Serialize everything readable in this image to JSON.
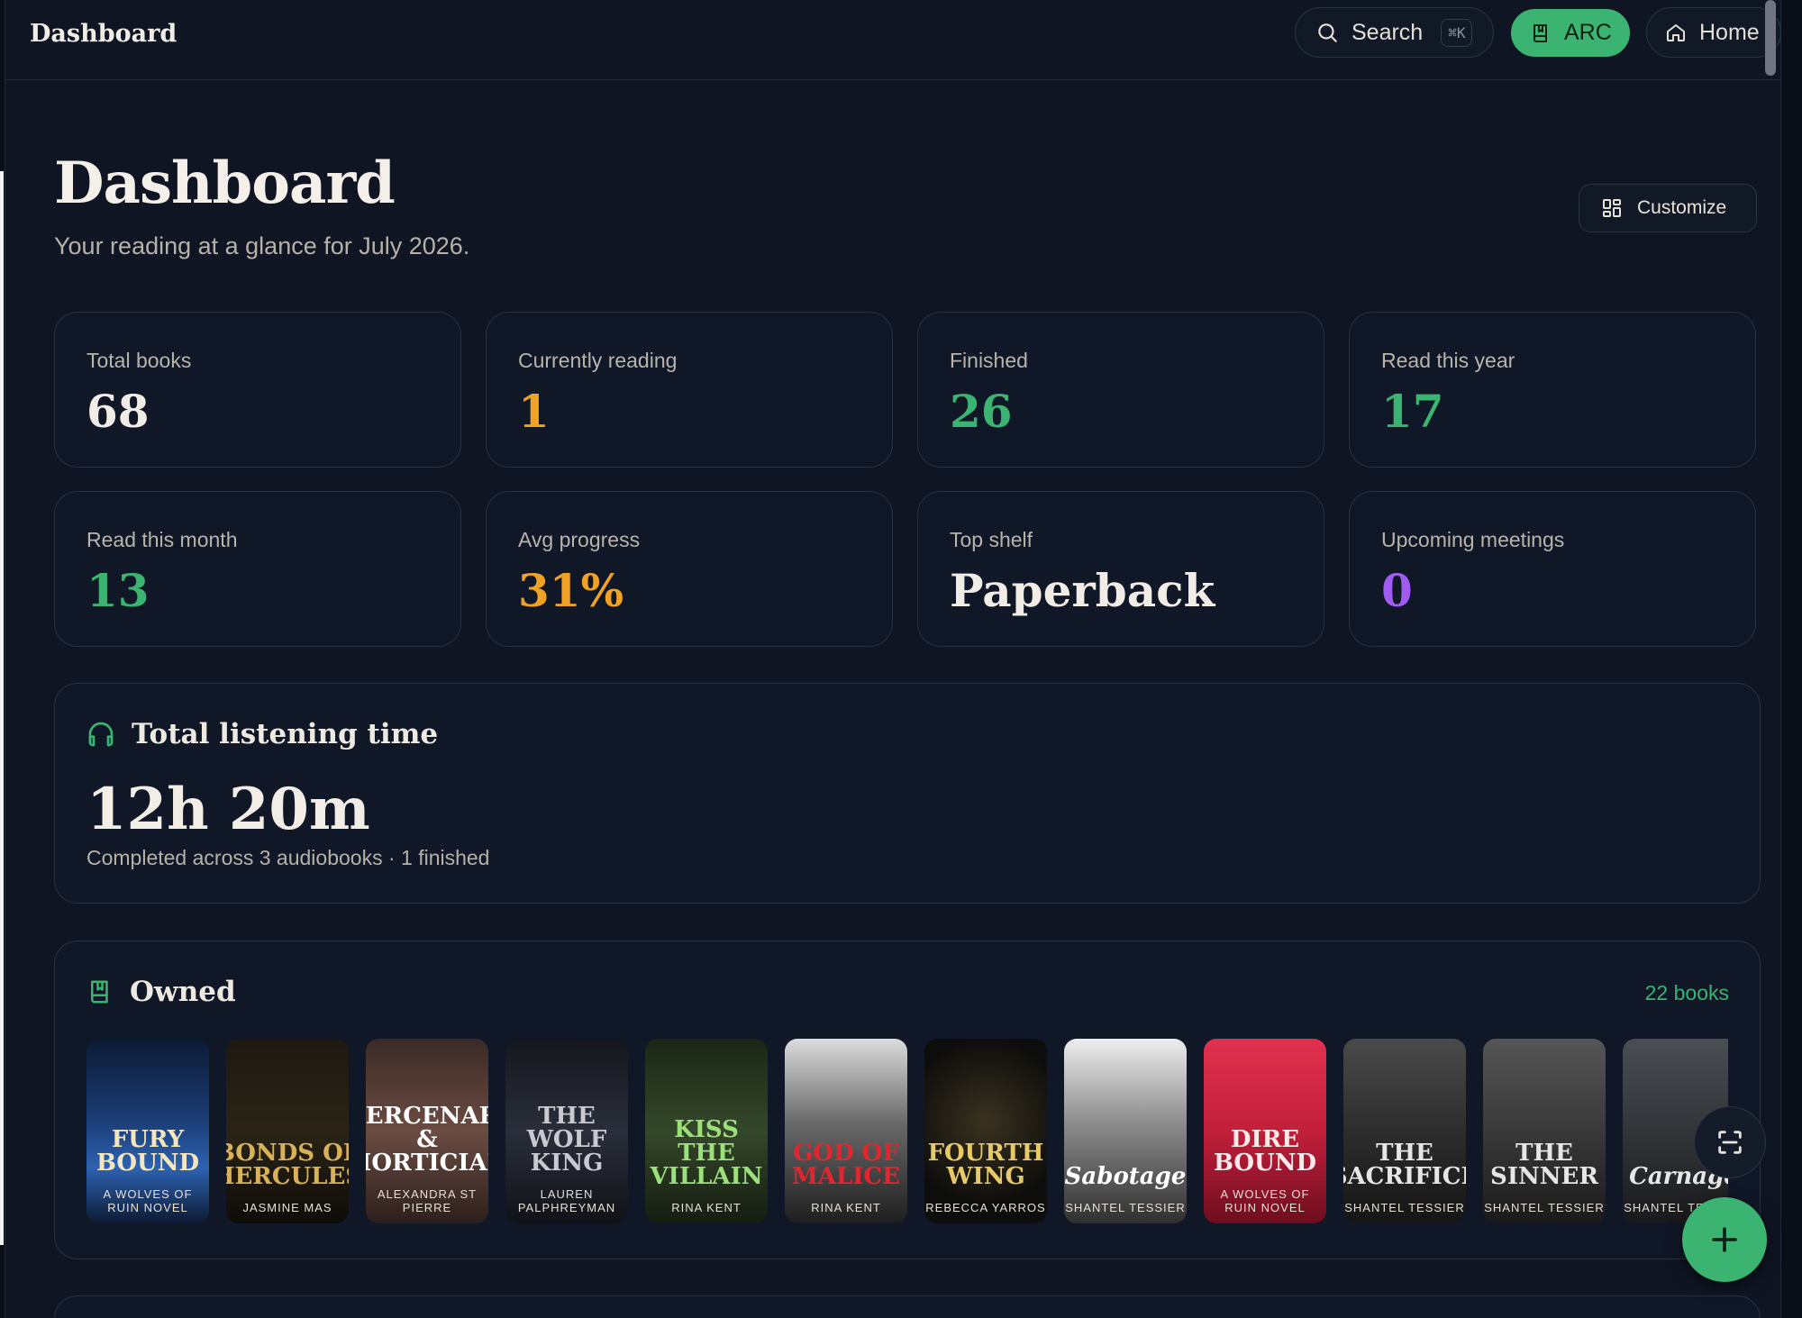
{
  "topbar": {
    "title": "Dashboard",
    "search_label": "Search",
    "search_shortcut": "⌘K",
    "arc_label": "ARC",
    "home_label": "Home"
  },
  "header": {
    "title": "Dashboard",
    "subtitle": "Your reading at a glance for July 2026.",
    "customize_label": "Customize"
  },
  "stats": [
    {
      "label": "Total books",
      "value": "68",
      "color": "#f1ede6"
    },
    {
      "label": "Currently reading",
      "value": "1",
      "color": "#f0a224"
    },
    {
      "label": "Finished",
      "value": "26",
      "color": "#3bb371"
    },
    {
      "label": "Read this year",
      "value": "17",
      "color": "#3bb371"
    },
    {
      "label": "Read this month",
      "value": "13",
      "color": "#3bb371"
    },
    {
      "label": "Avg progress",
      "value": "31%",
      "color": "#f0a224"
    },
    {
      "label": "Top shelf",
      "value": "Paperback",
      "color": "#f1ede6"
    },
    {
      "label": "Upcoming meetings",
      "value": "0",
      "color": "#a05cf0"
    }
  ],
  "listening": {
    "title": "Total listening time",
    "value": "12h 20m",
    "subtitle": "Completed across 3 audiobooks · 1 finished"
  },
  "owned": {
    "title": "Owned",
    "count": "22 books",
    "books": [
      {
        "title": "FURY BOUND",
        "author": "A WOLVES OF RUIN NOVEL",
        "bg": "#1b3e78"
      },
      {
        "title": "BONDS OF HERCULES",
        "author": "JASMINE MAS",
        "bg": "#171410"
      },
      {
        "title": "MERCENARY & MORTICIAN",
        "author": "ALEXANDRA ST PIERRE",
        "bg": "#5a4038"
      },
      {
        "title": "THE WOLF KING",
        "author": "LAUREN PALPHREYMAN",
        "bg": "#1d2029"
      },
      {
        "title": "KISS THE VILLAIN",
        "author": "RINA KENT",
        "bg": "#26331f"
      },
      {
        "title": "GOD OF MALICE",
        "author": "RINA KENT",
        "bg": "#3a3a3a"
      },
      {
        "title": "FOURTH WING",
        "author": "REBECCA YARROS",
        "bg": "#0d0d0b"
      },
      {
        "title": "Sabotage",
        "author": "SHANTEL TESSIER",
        "bg": "#4a4a4a"
      },
      {
        "title": "DIRE BOUND",
        "author": "A WOLVES OF RUIN NOVEL",
        "bg": "#c21f3a"
      },
      {
        "title": "THE SACRIFICE",
        "author": "SHANTEL TESSIER",
        "bg": "#2a2a2a"
      },
      {
        "title": "THE SINNER",
        "author": "SHANTEL TESSIER",
        "bg": "#363636"
      },
      {
        "title": "Carnage",
        "author": "SHANTEL TESSIER",
        "bg": "#303236"
      }
    ]
  },
  "icons": {
    "search": "search-icon",
    "arc": "book-icon",
    "home": "home-icon",
    "customize": "grid-icon",
    "listening": "headphones-icon",
    "owned": "book-icon",
    "scan": "scan-icon",
    "add": "plus-icon"
  },
  "colors": {
    "accent": "#3bb371",
    "amber": "#f0a224",
    "purple": "#a05cf0",
    "background": "#0f1523"
  }
}
